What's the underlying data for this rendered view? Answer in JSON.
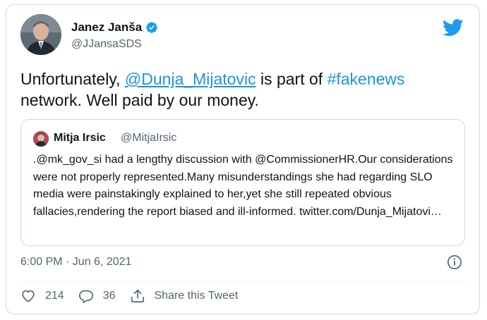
{
  "tweet": {
    "author_name": "Janez Janša",
    "author_handle": "@JJansaSDS",
    "text_before": "Unfortunately, ",
    "mention": "@Dunja_Mijatovic",
    "text_middle": " is part of ",
    "hashtag": "#fakenews",
    "text_after": " network. Well paid by our money.",
    "timestamp": "6:00 PM · Jun 6, 2021",
    "likes": "214",
    "replies": "36",
    "share_label": "Share this Tweet"
  },
  "quoted": {
    "author_name": "Mitja Irsic",
    "author_handle": "@MitjaIrsic",
    "text": ".@mk_gov_si had a lengthy discussion with @CommissionerHR.Our considerations were not properly represented.Many misunderstandings she had regarding SLO media were painstakingly explained to her,yet she still repeated obvious fallacies,rendering the report biased and ill-informed. twitter.com/Dunja_Mijatovi…"
  },
  "icons": {
    "verified": "verified-badge-icon",
    "logo": "twitter-bird-icon",
    "info": "info-icon",
    "like": "heart-icon",
    "reply": "reply-bubble-icon",
    "share": "share-icon"
  },
  "colors": {
    "accent": "#1d9bf0",
    "link": "#1b95e0",
    "muted": "#536471",
    "border": "#cfd9de"
  }
}
